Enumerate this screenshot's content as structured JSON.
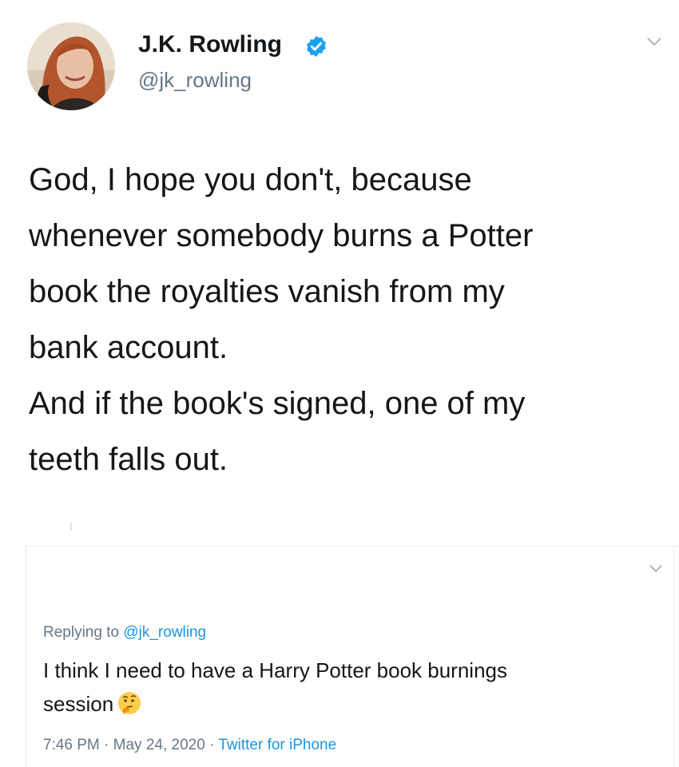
{
  "author": {
    "name": "J.K. Rowling",
    "handle": "@jk_rowling",
    "verified": true
  },
  "tweet": {
    "lines": [
      "God, I hope you don't, because",
      "whenever somebody burns a Potter",
      "book the royalties vanish from my",
      "bank account.",
      "And if the book's signed, one of my",
      "teeth falls out."
    ]
  },
  "reply": {
    "replying_prefix": "Replying to",
    "replying_to": "@jk_rowling",
    "text_line1": "I think I need to have a Harry Potter book burnings",
    "text_line2": "session",
    "emoji": "thinking-face-emoji"
  },
  "meta": {
    "time": "7:46 PM",
    "separator": "·",
    "date": "May 24, 2020",
    "source": "Twitter for iPhone"
  },
  "icons": {
    "verified": "verified-badge-icon",
    "caret": "chevron-down-icon"
  },
  "colors": {
    "text": "#14171a",
    "secondary": "#657786",
    "accent": "#1b95e0",
    "verified": "#1da1f2"
  }
}
